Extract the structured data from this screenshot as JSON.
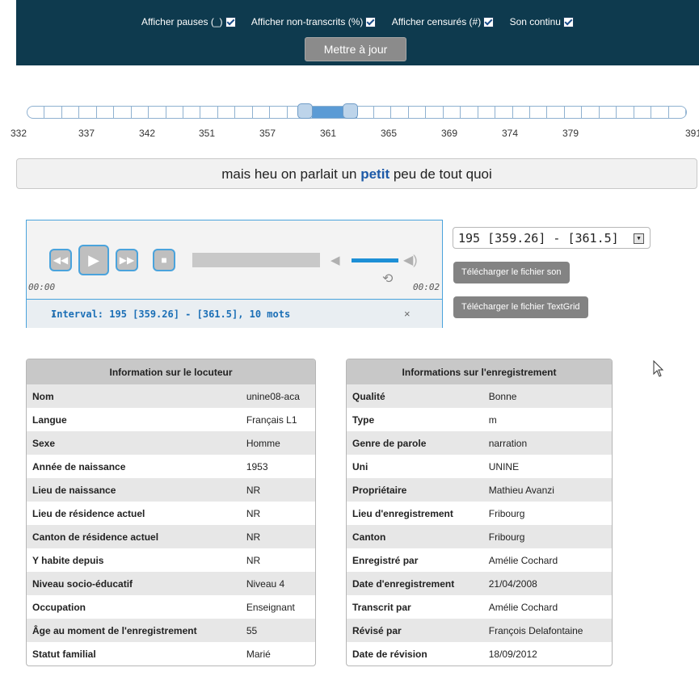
{
  "options": {
    "items": [
      {
        "label": "Afficher pauses (_)"
      },
      {
        "label": "Afficher non-transcrits (%)"
      },
      {
        "label": "Afficher censurés (#)"
      },
      {
        "label": "Son continu"
      }
    ],
    "update_label": "Mettre à jour"
  },
  "slider": {
    "ticks": [
      "332",
      "337",
      "342",
      "351",
      "357",
      "361",
      "365",
      "369",
      "374",
      "379",
      "391"
    ]
  },
  "transcript": {
    "before": "mais heu on parlait un ",
    "highlight": "petit",
    "after": " peu de tout quoi"
  },
  "player": {
    "current_time": "00:00",
    "duration": "00:02",
    "interval_label": "Interval: 195 [359.26] - [361.5], 10 mots",
    "close": "×"
  },
  "interval_select": {
    "value": "195 [359.26] - [361.5]"
  },
  "downloads": {
    "sound": "Télécharger le fichier son",
    "textgrid": "Télécharger le fichier TextGrid"
  },
  "speaker": {
    "title": "Information sur le locuteur",
    "rows": [
      {
        "k": "Nom",
        "v": "unine08-aca"
      },
      {
        "k": "Langue",
        "v": "Français L1"
      },
      {
        "k": "Sexe",
        "v": "Homme"
      },
      {
        "k": "Année de naissance",
        "v": "1953"
      },
      {
        "k": "Lieu de naissance",
        "v": "NR"
      },
      {
        "k": "Lieu de résidence actuel",
        "v": "NR"
      },
      {
        "k": "Canton de résidence actuel",
        "v": "NR"
      },
      {
        "k": "Y habite depuis",
        "v": "NR"
      },
      {
        "k": "Niveau socio-éducatif",
        "v": "Niveau 4"
      },
      {
        "k": "Occupation",
        "v": "Enseignant"
      },
      {
        "k": "Âge au moment de l'enregistrement",
        "v": "55"
      },
      {
        "k": "Statut familial",
        "v": "Marié"
      }
    ]
  },
  "recording": {
    "title": "Informations sur l'enregistrement",
    "rows": [
      {
        "k": "Qualité",
        "v": "Bonne"
      },
      {
        "k": "Type",
        "v": "m"
      },
      {
        "k": "Genre de parole",
        "v": "narration"
      },
      {
        "k": "Uni",
        "v": "UNINE"
      },
      {
        "k": "Propriétaire",
        "v": "Mathieu Avanzi"
      },
      {
        "k": "Lieu d'enregistrement",
        "v": "Fribourg"
      },
      {
        "k": "Canton",
        "v": "Fribourg"
      },
      {
        "k": "Enregistré par",
        "v": "Amélie Cochard"
      },
      {
        "k": "Date d'enregistrement",
        "v": "21/04/2008"
      },
      {
        "k": "Transcrit par",
        "v": "Amélie Cochard"
      },
      {
        "k": "Révisé par",
        "v": "François Delafontaine"
      },
      {
        "k": "Date de révision",
        "v": "18/09/2012"
      }
    ]
  }
}
